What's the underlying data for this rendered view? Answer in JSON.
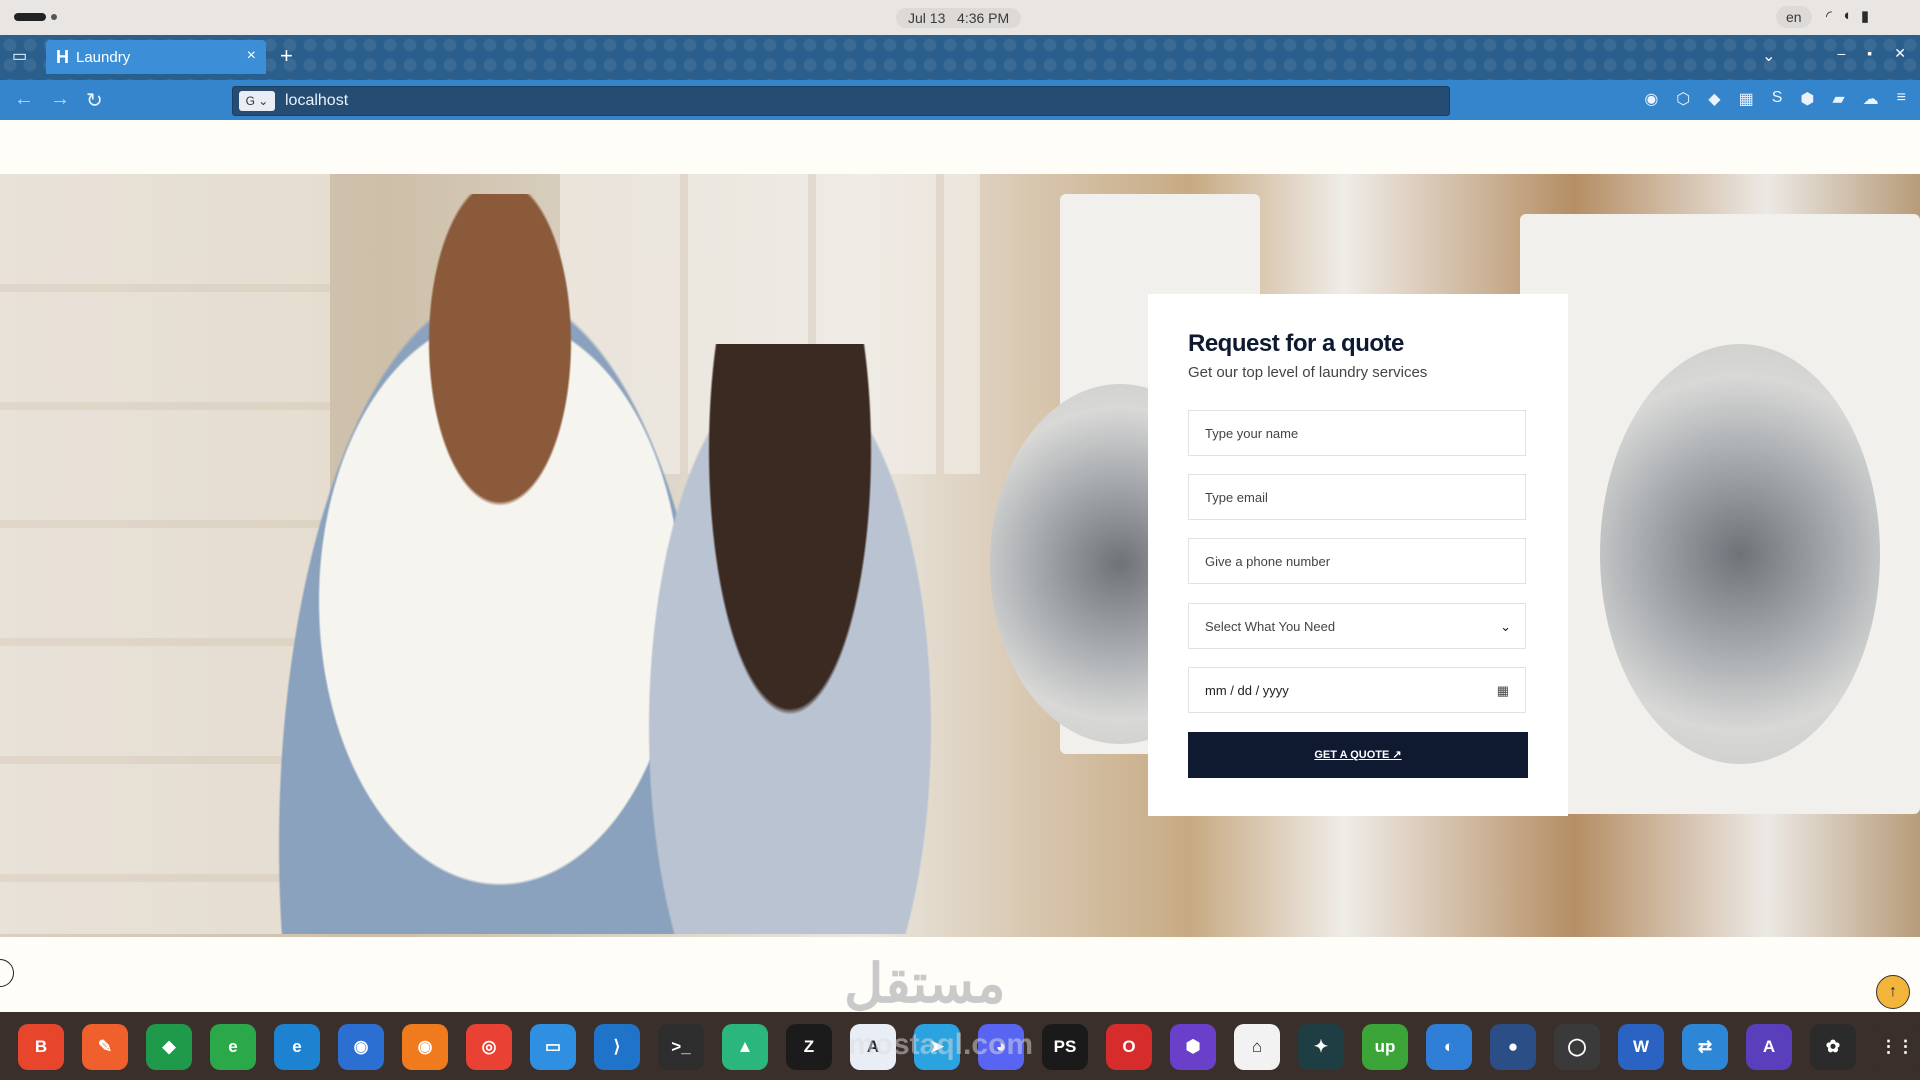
{
  "os": {
    "date": "Jul 13",
    "time": "4:36 PM",
    "lang": "en",
    "tray": [
      "wifi-icon",
      "volume-icon",
      "battery-icon"
    ]
  },
  "browser": {
    "tab_title": "Laundry",
    "tab_icon_letter": "H",
    "close_glyph": "×",
    "new_tab_glyph": "+",
    "url": "localhost",
    "google_glyph": "G ⌄",
    "window_controls": [
      "–",
      "▪",
      "✕"
    ],
    "nav": {
      "back": "←",
      "forward": "→",
      "reload": "↻"
    },
    "extensions": [
      "◉",
      "⬡",
      "◆",
      "▦",
      "S",
      "⬢",
      "▰",
      "☁",
      "≡"
    ]
  },
  "quote_form": {
    "title": "Request for a quote",
    "subtitle": "Get our top level of laundry services",
    "name_placeholder": "Type your name",
    "email_placeholder": "Type email",
    "phone_placeholder": "Give a phone number",
    "service_select": "Select What You Need",
    "date_placeholder": "mm / dd / yyyy",
    "submit_label": "GET A QUOTE ↗"
  },
  "page": {
    "watermark": "مستقل",
    "scroll_top_glyph": "↑"
  },
  "dock": {
    "watermark": "mostaql.com",
    "apps": [
      {
        "label": "B",
        "color": "#e8462c"
      },
      {
        "label": "✎",
        "color": "#f0602c"
      },
      {
        "label": "◆",
        "color": "#1e9a4a"
      },
      {
        "label": "e",
        "color": "#2aa84a"
      },
      {
        "label": "e",
        "color": "#1d82d0"
      },
      {
        "label": "◉",
        "color": "#2b6fd2"
      },
      {
        "label": "◉",
        "color": "#f07a1e"
      },
      {
        "label": "◎",
        "color": "#e94235"
      },
      {
        "label": "▭",
        "color": "#2f8fe0"
      },
      {
        "label": "⟩",
        "color": "#1f74c9"
      },
      {
        "label": ">_",
        "color": "#2d2d2d"
      },
      {
        "label": "▲",
        "color": "#2bb67d"
      },
      {
        "label": "Z",
        "color": "#1b1b1b"
      },
      {
        "label": "A",
        "color": "#e9eef6"
      },
      {
        "label": "➤",
        "color": "#2aa3e0"
      },
      {
        "label": "◕",
        "color": "#5865f2"
      },
      {
        "label": "PS",
        "color": "#1a1a1a"
      },
      {
        "label": "O",
        "color": "#d62c2c"
      },
      {
        "label": "⬢",
        "color": "#6a3fc9"
      },
      {
        "label": "⌂",
        "color": "#f2f2f2"
      },
      {
        "label": "✦",
        "color": "#1f3e44"
      },
      {
        "label": "up",
        "color": "#3ba53a"
      },
      {
        "label": "◐",
        "color": "#2f7fd6"
      },
      {
        "label": "●",
        "color": "#2b4e86"
      },
      {
        "label": "◯",
        "color": "#3a3a3a"
      },
      {
        "label": "W",
        "color": "#2a63c2"
      },
      {
        "label": "⇄",
        "color": "#2e86d6"
      },
      {
        "label": "A",
        "color": "#5a3fbd"
      },
      {
        "label": "✿",
        "color": "#2b2b2b"
      },
      {
        "label": "⋮⋮",
        "color": "#3b2f2b"
      }
    ]
  }
}
